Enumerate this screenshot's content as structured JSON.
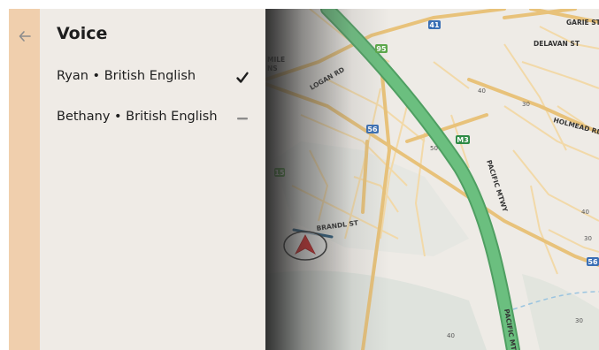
{
  "panel": {
    "title": "Voice",
    "back_icon": "arrow-left-icon",
    "voices": [
      {
        "label": "Ryan • British English",
        "state": "selected",
        "icon": "checkmark-icon"
      },
      {
        "label": "Bethany • British English",
        "state": "unselected",
        "icon": "dash-icon"
      }
    ]
  },
  "map": {
    "street_labels": [
      "GARIE ST",
      "DELAVAN ST",
      "LOGAN RD",
      "HOLMEAD RD",
      "PACIFIC MTWY",
      "BRANDL ST",
      "PACIFIC MTWY",
      "MILE",
      "NS"
    ],
    "route_shields": [
      "41",
      "95",
      "56",
      "M3",
      "56",
      "15"
    ],
    "speed_labels": [
      "40",
      "30",
      "50",
      "40",
      "30",
      "40",
      "30"
    ],
    "position_marker_icon": "navigation-arrow-icon"
  },
  "colors": {
    "panel_background": "#efebe6",
    "back_strip": "#f0cfad",
    "motorway": "#6bbf7f",
    "major_road": "#e8c27a",
    "position_marker": "#e02525"
  }
}
